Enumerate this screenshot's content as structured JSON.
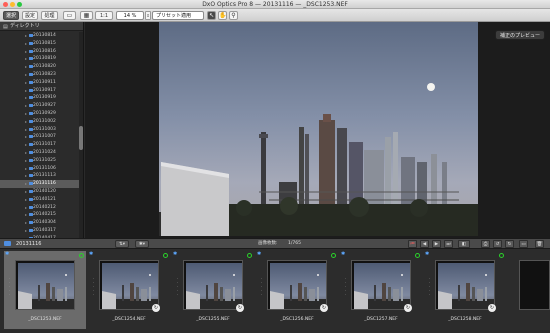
{
  "window": {
    "title": "DxO Optics Pro 8 — 20131116 — _DSC1253.NEF"
  },
  "toolbar": {
    "tabs": [
      "選択",
      "設定",
      "処理"
    ],
    "compare_label": "1:1",
    "zoom": "14 %",
    "preset": "プリセット適用"
  },
  "sidebar": {
    "title": "ディレクトリ",
    "folders": [
      "20130814",
      "20130815",
      "20130816",
      "20130819",
      "20130820",
      "20130823",
      "20130911",
      "20130917",
      "20130919",
      "20130927",
      "20130929",
      "20131002",
      "20131003",
      "20131007",
      "20131017",
      "20131024",
      "20131025",
      "20131106",
      "20131113",
      "20131116",
      "20140120",
      "20140121",
      "20140212",
      "20140215",
      "20140304",
      "20140317",
      "20140417",
      "20140419"
    ],
    "selected": "20131116"
  },
  "viewer": {
    "preview_button": "補正のプレビュー"
  },
  "filmstrip_bar": {
    "folder": "20131116",
    "count_label": "画像枚数:",
    "count": "1/765"
  },
  "filmstrip": {
    "items": [
      {
        "name": "_DSC1253.NEF"
      },
      {
        "name": "_DSC1254.NEF"
      },
      {
        "name": "_DSC1255.NEF"
      },
      {
        "name": "_DSC1256.NEF"
      },
      {
        "name": "_DSC1257.NEF"
      },
      {
        "name": "_DSC1258.NEF"
      }
    ]
  },
  "colors": {
    "accent": "#4f8ee0",
    "sky": "#8490a8",
    "selection": "#5b5b5b"
  }
}
